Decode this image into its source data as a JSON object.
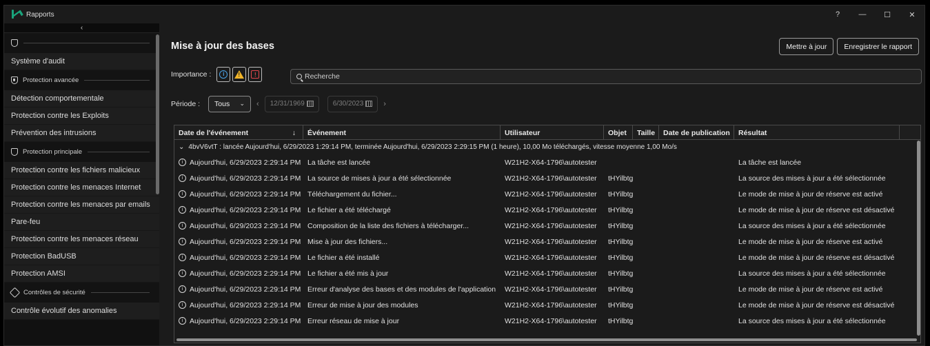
{
  "window": {
    "title": "Rapports",
    "controls": [
      "?",
      "—",
      "☐",
      "✕"
    ]
  },
  "sidebar": {
    "collapse_glyph": "‹",
    "top_section": "",
    "sections": [
      {
        "label": "",
        "items": [
          "Système d'audit"
        ]
      },
      {
        "label": "Protection avancée",
        "items": [
          "Détection comportementale",
          "Protection contre les Exploits",
          "Prévention des intrusions"
        ]
      },
      {
        "label": "Protection principale",
        "items": [
          "Protection contre les fichiers malicieux",
          "Protection contre les menaces Internet",
          "Protection contre les menaces par emails",
          "Pare-feu",
          "Protection contre les menaces réseau",
          "Protection BadUSB",
          "Protection AMSI"
        ]
      },
      {
        "label": "Contrôles de sécurité",
        "items": [
          "Contrôle évolutif des anomalies"
        ]
      }
    ]
  },
  "main": {
    "title": "Mise à jour des bases",
    "buttons": {
      "update": "Mettre à jour",
      "save_report": "Enregistrer le rapport"
    },
    "importance_label": "Importance :",
    "search_placeholder": "Recherche",
    "period_label": "Période :",
    "period_value": "Tous",
    "date_from": "12/31/1969",
    "date_to": "6/30/2023",
    "columns": [
      "Date de l'événement",
      "Événement",
      "Utilisateur",
      "Objet",
      "Taille",
      "Date de publication",
      "Résultat"
    ],
    "sort_glyph": "↓",
    "group_row": "4bvV6vtT : lancée Aujourd'hui, 6/29/2023 1:29:14 PM, terminée Aujourd'hui, 6/29/2023 2:29:15 PM (1 heure), 10,00 Mo téléchargés, vitesse moyenne 1,00 Mo/s",
    "rows": [
      {
        "date": "Aujourd'hui, 6/29/2023 2:29:14 PM",
        "event": "La tâche est lancée",
        "user": "W21H2-X64-1796\\autotester",
        "object": "",
        "result": "La tâche est lancée"
      },
      {
        "date": "Aujourd'hui, 6/29/2023 2:29:14 PM",
        "event": "La source de mises à jour a été sélectionnée",
        "user": "W21H2-X64-1796\\autotester",
        "object": "tHYilbtg",
        "result": "La source des mises à jour a été sélectionnée"
      },
      {
        "date": "Aujourd'hui, 6/29/2023 2:29:14 PM",
        "event": "Téléchargement du fichier...",
        "user": "W21H2-X64-1796\\autotester",
        "object": "tHYilbtg",
        "result": "Le mode de mise à jour de réserve est activé"
      },
      {
        "date": "Aujourd'hui, 6/29/2023 2:29:14 PM",
        "event": "Le fichier a été téléchargé",
        "user": "W21H2-X64-1796\\autotester",
        "object": "tHYilbtg",
        "result": "Le mode de mise à jour de réserve est désactivé"
      },
      {
        "date": "Aujourd'hui, 6/29/2023 2:29:14 PM",
        "event": "Composition de la liste des fichiers à télécharger...",
        "user": "W21H2-X64-1796\\autotester",
        "object": "tHYilbtg",
        "result": "La source des mises à jour a été sélectionnée"
      },
      {
        "date": "Aujourd'hui, 6/29/2023 2:29:14 PM",
        "event": "Mise à jour des fichiers...",
        "user": "W21H2-X64-1796\\autotester",
        "object": "tHYilbtg",
        "result": "Le mode de mise à jour de réserve est activé"
      },
      {
        "date": "Aujourd'hui, 6/29/2023 2:29:14 PM",
        "event": "Le fichier a été installé",
        "user": "W21H2-X64-1796\\autotester",
        "object": "tHYilbtg",
        "result": "Le mode de mise à jour de réserve est désactivé"
      },
      {
        "date": "Aujourd'hui, 6/29/2023 2:29:14 PM",
        "event": "Le fichier a été mis à jour",
        "user": "W21H2-X64-1796\\autotester",
        "object": "tHYilbtg",
        "result": "La source des mises à jour a été sélectionnée"
      },
      {
        "date": "Aujourd'hui, 6/29/2023 2:29:14 PM",
        "event": "Erreur d'analyse des bases et des modules de l'application",
        "user": "W21H2-X64-1796\\autotester",
        "object": "tHYilbtg",
        "result": "Le mode de mise à jour de réserve est activé"
      },
      {
        "date": "Aujourd'hui, 6/29/2023 2:29:14 PM",
        "event": "Erreur de mise à jour des modules",
        "user": "W21H2-X64-1796\\autotester",
        "object": "tHYilbtg",
        "result": "Le mode de mise à jour de réserve est désactivé"
      },
      {
        "date": "Aujourd'hui, 6/29/2023 2:29:14 PM",
        "event": "Erreur réseau de mise à jour",
        "user": "W21H2-X64-1796\\autotester",
        "object": "tHYilbtg",
        "result": "La source des mises à jour a été sélectionnée"
      }
    ]
  },
  "colors": {
    "accent": "#19a37b",
    "info": "#4aa3e8",
    "warning": "#f0b429",
    "critical": "#e5484d"
  }
}
